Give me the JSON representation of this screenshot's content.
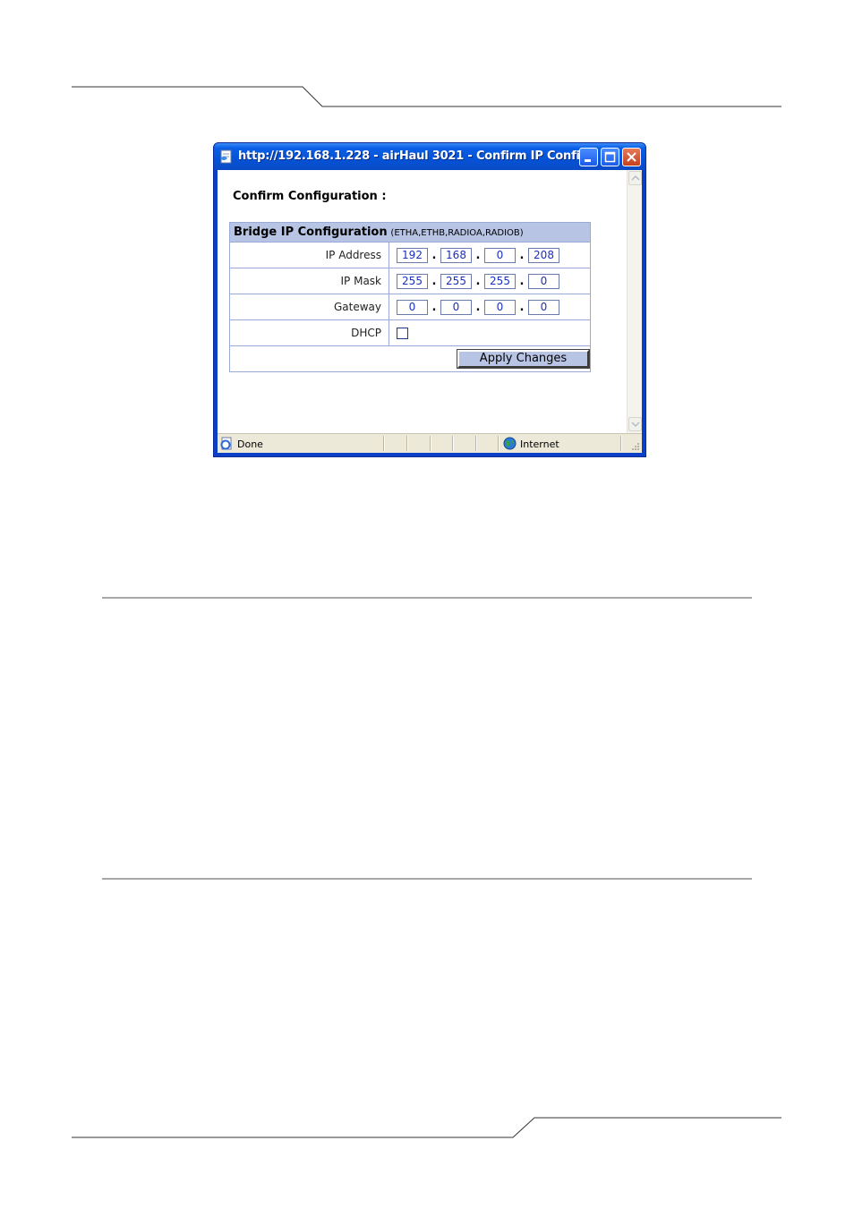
{
  "window": {
    "title": "http://192.168.1.228 - airHaul 3021 - Confirm IP Confi...",
    "controls": {
      "minimize": "minimize-icon",
      "maximize": "maximize-icon",
      "close": "close-icon"
    }
  },
  "content": {
    "heading": "Confirm Configuration :",
    "table": {
      "header_main": "Bridge IP Configuration",
      "header_sub": "(ETHA,ETHB,RADIOA,RADIOB)",
      "rows": {
        "ip_address": {
          "label": "IP Address",
          "octets": [
            "192",
            "168",
            "0",
            "208"
          ]
        },
        "ip_mask": {
          "label": "IP Mask",
          "octets": [
            "255",
            "255",
            "255",
            "0"
          ]
        },
        "gateway": {
          "label": "Gateway",
          "octets": [
            "0",
            "0",
            "0",
            "0"
          ]
        },
        "dhcp": {
          "label": "DHCP",
          "checked": false
        }
      },
      "separator": ".",
      "apply_label": "Apply Changes"
    }
  },
  "statusbar": {
    "status_text": "Done",
    "zone_text": "Internet"
  },
  "colors": {
    "title_bar": "#0553d6",
    "table_header": "#b7c4e4",
    "input_text": "#1a2fc0"
  }
}
